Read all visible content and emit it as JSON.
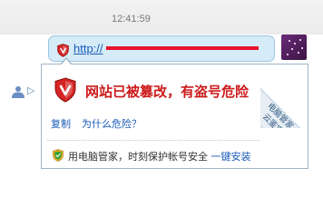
{
  "chat": {
    "timestamp": "12:41:59",
    "link_text": "http://"
  },
  "popup": {
    "warning_title": "网站已被篡改，有盗号危险",
    "copy_link": "复制",
    "why_link": "为什么危险？",
    "ribbon_line1": "电脑管家",
    "ribbon_line2": "云鉴定",
    "footer_text": "用电脑管家，时刻保护帐号安全",
    "install_link": "一键安装"
  },
  "sidebar": {
    "arrow": "▷"
  },
  "colors": {
    "warning_red": "#cc1a1a",
    "link_blue": "#1a5bb8",
    "bubble_bg": "#d6ebf8",
    "redaction": "#e8112d"
  },
  "icons": {
    "bubble": "shield-warning-icon",
    "popup": "shield-warning-icon",
    "footer": "guardian-shield-icon",
    "left": "user-icon"
  }
}
